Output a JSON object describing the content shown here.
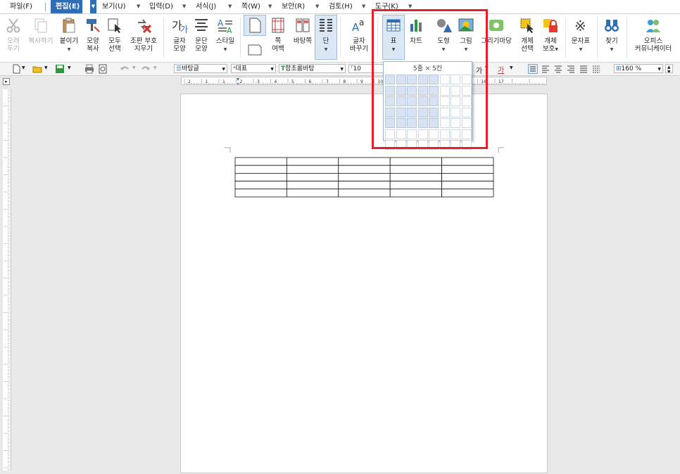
{
  "menu": {
    "items": [
      {
        "label": "파일(F)",
        "active": false
      },
      {
        "label": "편집(E)",
        "active": true
      },
      {
        "label": "보기(U)",
        "active": false
      },
      {
        "label": "입력(D)",
        "active": false
      },
      {
        "label": "서식(J)",
        "active": false
      },
      {
        "label": "쪽(W)",
        "active": false
      },
      {
        "label": "보안(R)",
        "active": false
      },
      {
        "label": "검토(H)",
        "active": false
      },
      {
        "label": "도구(K)",
        "active": false
      }
    ]
  },
  "ribbon": {
    "cut": "오려\n두기",
    "copy": "복사하기",
    "paste": "붙이기",
    "format_copy": "모양\n복사",
    "select_all": "모두\n선택",
    "clear_format": "조판 부호\n지우기",
    "char_shape": "글자\n모양",
    "para_shape": "문단\n모양",
    "style": "스타일",
    "page_margin": "쪽\n여백",
    "background": "바탕쪽",
    "column": "단",
    "replace": "글자\n바꾸기",
    "table": "표",
    "chart": "차트",
    "shape": "도형",
    "picture": "그림",
    "drawing_gallery": "그리기마당",
    "select_object": "개체\n선택",
    "protect_object": "개체\n보호",
    "symbol": "문자표",
    "find": "찾기",
    "office_community": "오피스\n커뮤니케이터"
  },
  "format_bar": {
    "style_name": "바탕글",
    "lang": "대표",
    "font_name": "함초롬바탕",
    "font_size": "10",
    "zoom": "160",
    "zoom_unit": "%"
  },
  "table_picker": {
    "header": "5줄 × 5칸",
    "rows": 7,
    "cols": 8,
    "sel_rows": 5,
    "sel_cols": 5
  },
  "document_table": {
    "rows": 5,
    "cols": 5
  },
  "ruler": {
    "ticks": [
      "2",
      "1",
      "1",
      "2",
      "3",
      "4",
      "5",
      "6",
      "7",
      "8",
      "9",
      "10",
      "11",
      "12",
      "13",
      "14",
      "15",
      "16",
      "17"
    ]
  },
  "colors": {
    "highlight": "#e5202e",
    "menu_active": "#2f6eb5",
    "grid_selected": "#d7e3f2"
  }
}
